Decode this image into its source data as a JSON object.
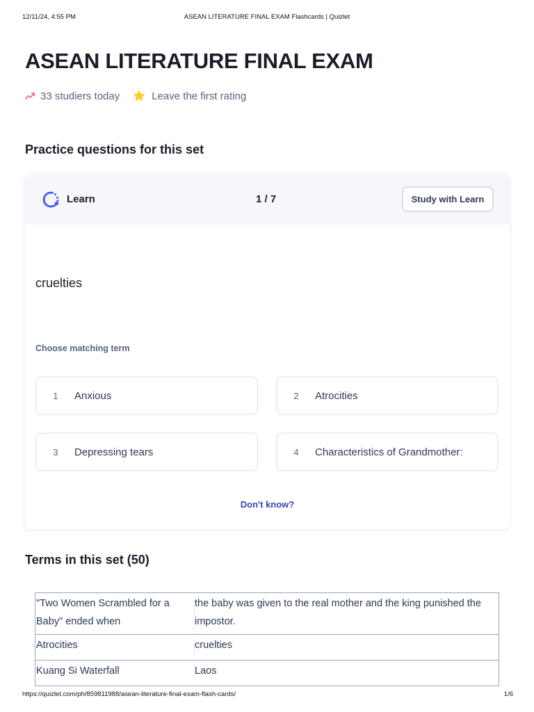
{
  "print_header": {
    "date": "12/11/24, 4:55 PM",
    "page_title": "ASEAN LITERATURE FINAL EXAM Flashcards | Quizlet"
  },
  "set": {
    "title": "ASEAN LITERATURE FINAL EXAM",
    "studiers": "33 studiers today",
    "rating": "Leave the first rating"
  },
  "practice": {
    "heading": "Practice questions for this set",
    "mode_label": "Learn",
    "progress": "1 / 7",
    "study_button": "Study with Learn",
    "prompt": "cruelties",
    "instruction": "Choose matching term",
    "options": [
      {
        "num": "1",
        "text": "Anxious"
      },
      {
        "num": "2",
        "text": "Atrocities"
      },
      {
        "num": "3",
        "text": "Depressing tears"
      },
      {
        "num": "4",
        "text": "Characteristics of Grandmother:"
      }
    ],
    "dont_know": "Don't know?"
  },
  "terms": {
    "heading": "Terms in this set (50)",
    "rows": [
      {
        "term": "\"Two Women Scrambled for a Baby\" ended when",
        "definition": "the baby was given to the real mother and the king punished the impostor."
      },
      {
        "term": "Atrocities",
        "definition": "cruelties"
      },
      {
        "term": "Kuang Si Waterfall",
        "definition": "Laos"
      }
    ]
  },
  "print_footer": {
    "url": "https://quizlet.com/ph/859811988/asean-literature-final-exam-flash-cards/",
    "page": "1/6"
  },
  "colors": {
    "accent": "#4255ff",
    "link": "#3a46a8",
    "trend": "#ff5a6d",
    "star": "#ffcd1f",
    "text_secondary": "#586380"
  },
  "icons": {
    "trend": "trending-up-icon",
    "star": "star-icon",
    "learn": "learn-icon"
  }
}
